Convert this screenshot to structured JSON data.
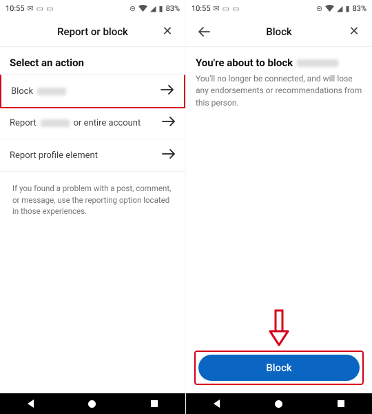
{
  "status": {
    "time": "10:55",
    "battery": "83%"
  },
  "left": {
    "header": {
      "title": "Report or block"
    },
    "section_title": "Select an action",
    "actions": {
      "block_prefix": "Block",
      "report_prefix": "Report",
      "report_suffix": "or entire account",
      "profile": "Report profile element"
    },
    "hint": "If you found a problem with a post, comment, or message, use the reporting option located in those experiences."
  },
  "right": {
    "header": {
      "title": "Block"
    },
    "heading_prefix": "You're about to block",
    "desc": "You'll no longer be connected, and will lose any endorsements or recommendations from this person.",
    "button": "Block"
  }
}
